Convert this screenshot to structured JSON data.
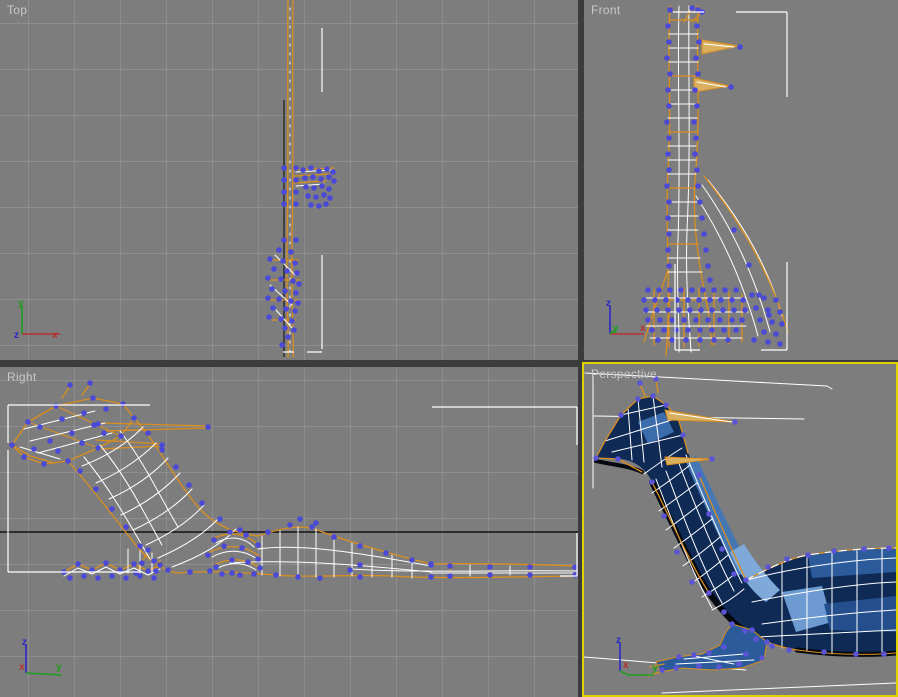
{
  "app": {
    "type": "3d-quad-viewport-editor"
  },
  "viewports": {
    "top": {
      "label": "Top",
      "active": false,
      "axis": {
        "up": "y",
        "right": "x",
        "origin": "z"
      }
    },
    "front": {
      "label": "Front",
      "active": false,
      "axis": {
        "up": "z",
        "right": "x",
        "origin": "y"
      }
    },
    "right": {
      "label": "Right",
      "active": false,
      "axis": {
        "up": "z",
        "right": "y",
        "origin": "x"
      }
    },
    "perspective": {
      "label": "Perspective",
      "active": true,
      "axis": {
        "up": "z",
        "right": "y",
        "origin": "x"
      }
    }
  },
  "colors": {
    "divider": "#3c3c3c",
    "viewport_bg": "#7d7d7d",
    "grid_line": "#8e8e8e",
    "label_text": "#c9c9c9",
    "active_border": "#e0d400",
    "wire_orange": "#d98e1f",
    "wire_white": "#ffffff",
    "vertex_blue": "#4a49d8",
    "vertex_violet": "#5b55d6",
    "axis_x_red": "#b93030",
    "axis_y_green": "#1f9e1f",
    "axis_z_blue": "#2828c8",
    "origin_black": "#111111",
    "shade_dark": "#0e2a55",
    "shade_mid": "#2c5b9c",
    "shade_light": "#7fa9d9"
  }
}
